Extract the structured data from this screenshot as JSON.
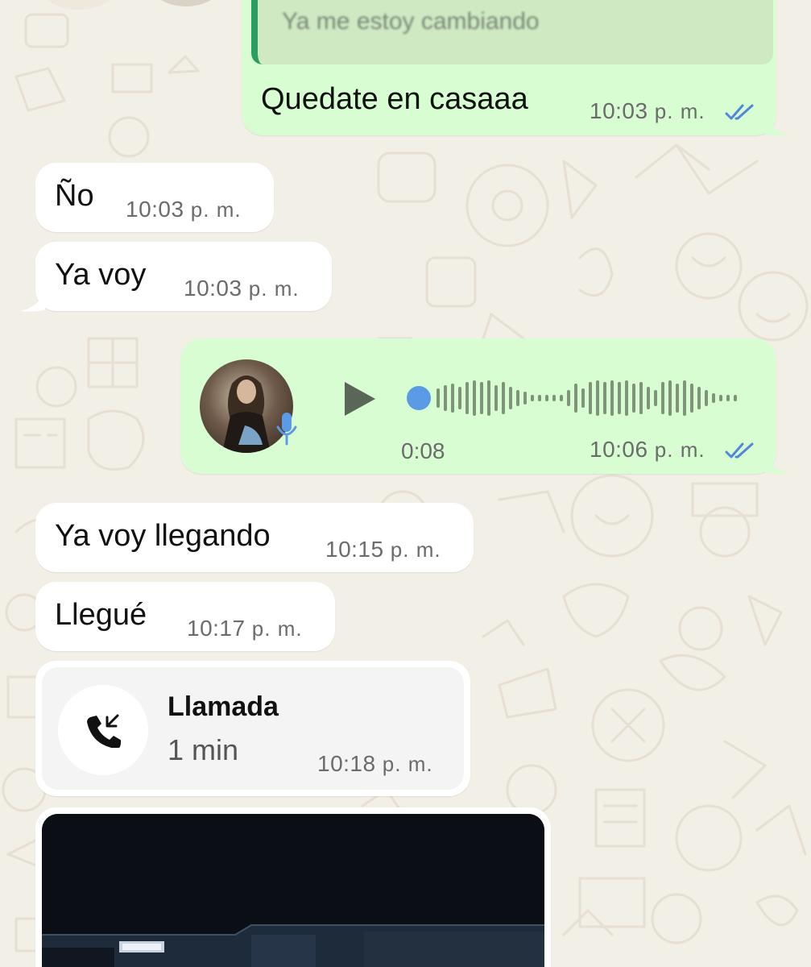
{
  "chat": {
    "quoted_message": "Ya me estoy cambiando",
    "messages": [
      {
        "direction": "outgoing",
        "text": "Quedate en casaaa",
        "time": "10:03",
        "ampm": "p. m.",
        "status": "read"
      },
      {
        "direction": "incoming",
        "text": "Ño",
        "time": "10:03",
        "ampm": "p. m."
      },
      {
        "direction": "incoming",
        "text": "Ya voy",
        "time": "10:03",
        "ampm": "p. m."
      },
      {
        "direction": "outgoing",
        "type": "voice",
        "duration": "0:08",
        "time": "10:06",
        "ampm": "p. m.",
        "status": "read"
      },
      {
        "direction": "incoming",
        "text": "Ya voy llegando",
        "time": "10:15",
        "ampm": "p. m."
      },
      {
        "direction": "incoming",
        "text": "Llegué",
        "time": "10:17",
        "ampm": "p. m."
      },
      {
        "direction": "incoming",
        "type": "call",
        "title": "Llamada",
        "duration": "1 min",
        "time": "10:18",
        "ampm": "p. m."
      },
      {
        "direction": "incoming",
        "type": "image"
      }
    ]
  },
  "colors": {
    "background": "#f2efe7",
    "incoming_bubble": "#ffffff",
    "outgoing_bubble": "#d9fdd3",
    "read_ticks": "#4f87d9",
    "quote_bar": "#2a9d62"
  },
  "icons": {
    "read_receipt": "double-check-icon",
    "voice_play": "play-icon",
    "voice_mic": "microphone-icon",
    "call": "incoming-call-icon"
  }
}
